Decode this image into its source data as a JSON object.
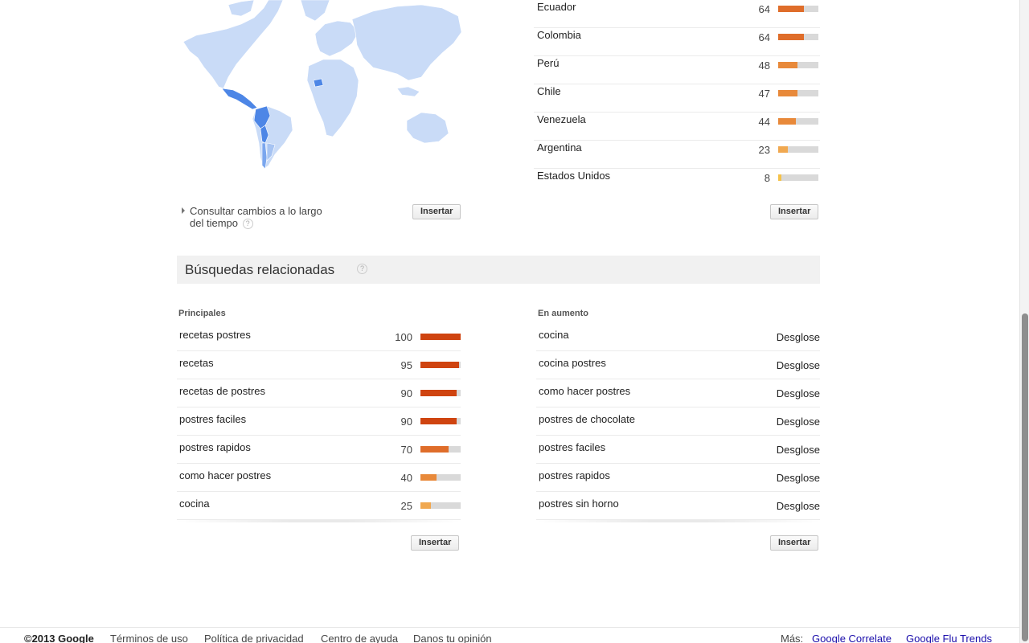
{
  "map": {
    "land_color": "#c9dbf7",
    "highlight_color": "#4d86e6",
    "mid_color": "#7aa6ee"
  },
  "regions": [
    {
      "name": "Ecuador",
      "value": 64,
      "bar_color": "#df6d2a",
      "fraction": 0.64
    },
    {
      "name": "Colombia",
      "value": 64,
      "bar_color": "#df6d2a",
      "fraction": 0.64
    },
    {
      "name": "Perú",
      "value": 48,
      "bar_color": "#e8893a",
      "fraction": 0.48
    },
    {
      "name": "Chile",
      "value": 47,
      "bar_color": "#e8893a",
      "fraction": 0.47
    },
    {
      "name": "Venezuela",
      "value": 44,
      "bar_color": "#e8893a",
      "fraction": 0.44
    },
    {
      "name": "Argentina",
      "value": 23,
      "bar_color": "#f0a850",
      "fraction": 0.23
    },
    {
      "name": "Estados Unidos",
      "value": 8,
      "bar_color": "#f5c24a",
      "fraction": 0.08
    }
  ],
  "change_over_time": {
    "line1": "Consultar cambios a lo largo",
    "line2": "del tiempo",
    "help": "?"
  },
  "embed_label": "Insertar",
  "related": {
    "title": "Búsquedas relacionadas",
    "help": "?",
    "top_label": "Principales",
    "rising_label": "En aumento",
    "top": [
      {
        "name": "recetas postres",
        "value": 100,
        "fraction": 1.0,
        "bar_color": "#cf4410"
      },
      {
        "name": "recetas",
        "value": 95,
        "fraction": 0.95,
        "bar_color": "#cf4410"
      },
      {
        "name": "recetas de postres",
        "value": 90,
        "fraction": 0.9,
        "bar_color": "#cf4410"
      },
      {
        "name": "postres faciles",
        "value": 90,
        "fraction": 0.9,
        "bar_color": "#cf4410"
      },
      {
        "name": "postres rapidos",
        "value": 70,
        "fraction": 0.7,
        "bar_color": "#df6d2a"
      },
      {
        "name": "como hacer postres",
        "value": 40,
        "fraction": 0.4,
        "bar_color": "#e8893a"
      },
      {
        "name": "cocina",
        "value": 25,
        "fraction": 0.25,
        "bar_color": "#f0a850"
      }
    ],
    "rising": [
      {
        "name": "cocina",
        "action": "Desglose"
      },
      {
        "name": "cocina postres",
        "action": "Desglose"
      },
      {
        "name": "como hacer postres",
        "action": "Desglose"
      },
      {
        "name": "postres de chocolate",
        "action": "Desglose"
      },
      {
        "name": "postres faciles",
        "action": "Desglose"
      },
      {
        "name": "postres rapidos",
        "action": "Desglose"
      },
      {
        "name": "postres sin horno",
        "action": "Desglose"
      }
    ]
  },
  "footer": {
    "copyright": "©2013 Google",
    "links": [
      "Términos de uso",
      "Política de privacidad",
      "Centro de ayuda",
      "Danos tu opinión"
    ],
    "more_label": "Más:",
    "more_links": [
      "Google Correlate",
      "Google Flu Trends"
    ]
  }
}
